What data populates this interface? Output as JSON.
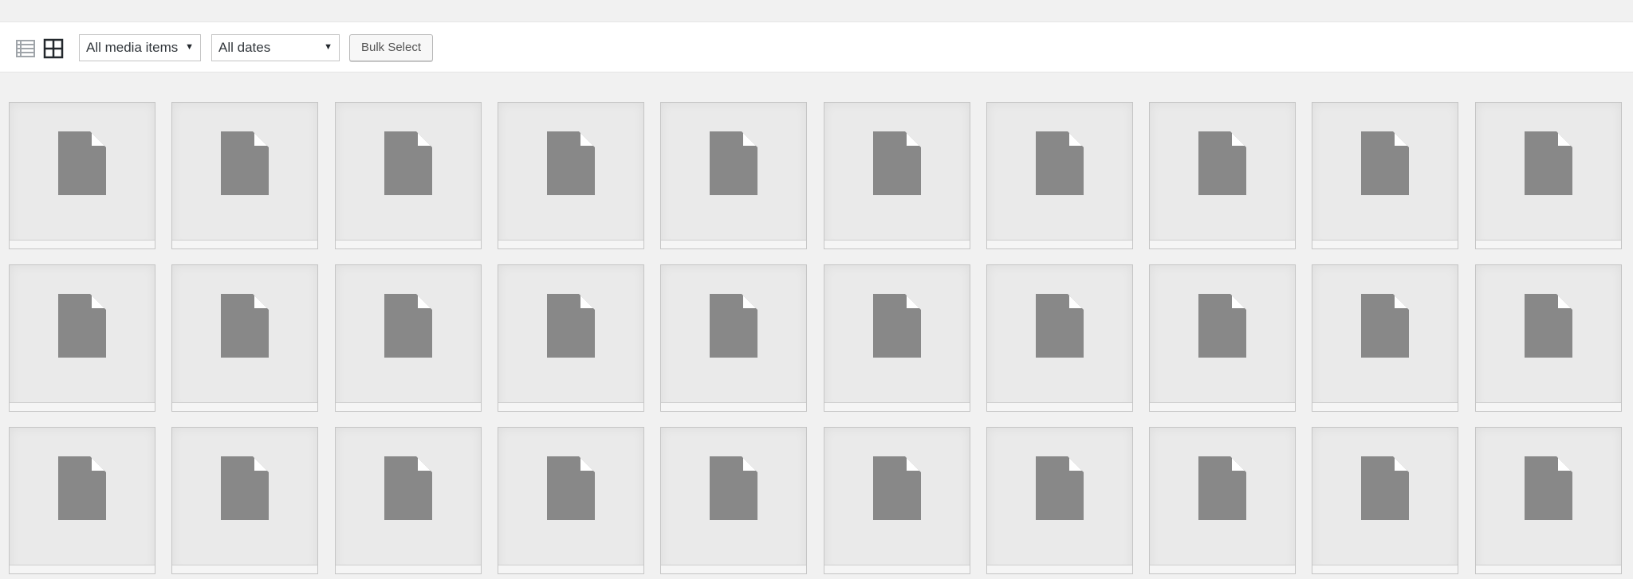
{
  "toolbar": {
    "list_view_icon": "list-view-icon",
    "grid_view_icon": "grid-view-icon",
    "type_filter": {
      "selected": "All media items"
    },
    "date_filter": {
      "selected": "All dates"
    },
    "bulk_select_label": "Bulk Select"
  },
  "media": {
    "rows": 3,
    "columns": 10,
    "item_icon": "document-icon"
  },
  "colors": {
    "background": "#f1f1f1",
    "toolbar": "#ffffff",
    "tile": "#eaeaea",
    "icon": "#888888"
  }
}
